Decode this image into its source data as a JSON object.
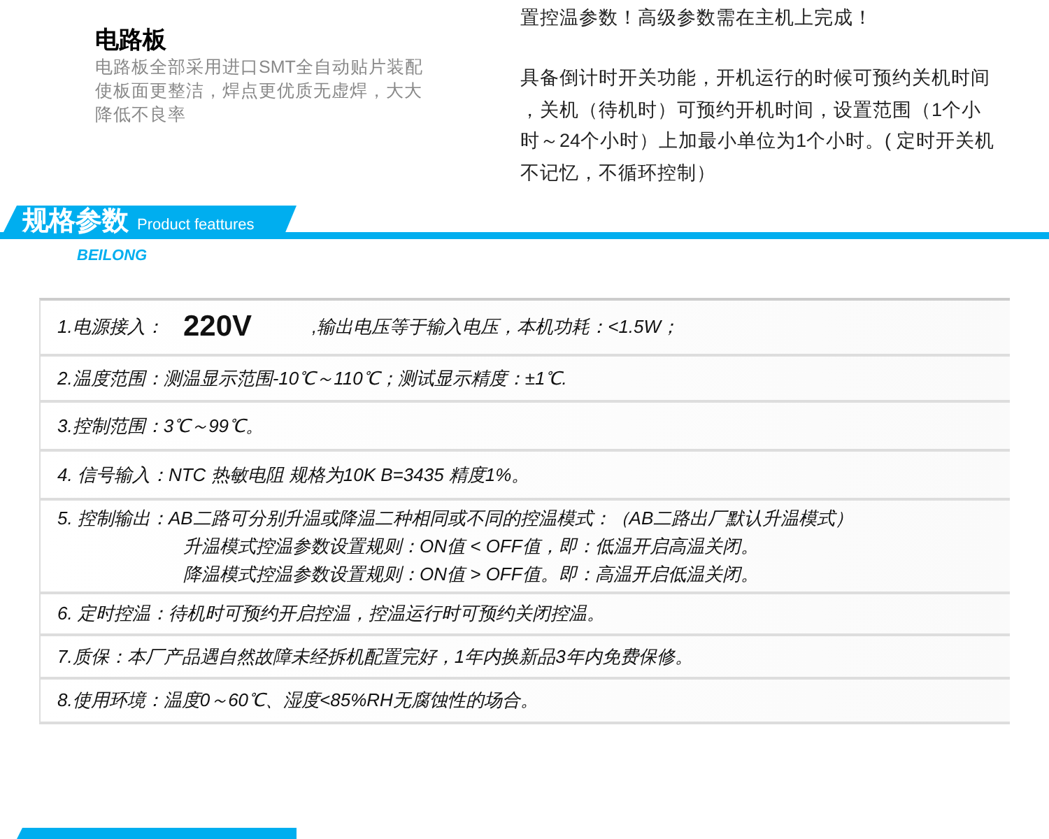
{
  "circuit_board": {
    "heading": "电路板",
    "description_lines": [
      "电路板全部采用进口SMT全自动贴片装配",
      "使板面更整洁，焊点更优质无虚焊，大大",
      "降低不良率"
    ]
  },
  "timer_text": {
    "intro": "置控温参数！高级参数需在主机上完成！",
    "lines": [
      "具备倒计时开关功能，开机运行的时候可预约关机时间",
      "，关机（待机时）可预约开机时间，设置范围（1个小",
      "时～24个小时）上加最小单位为1个小时。(  定时开关机",
      "不记忆，不循环控制）"
    ]
  },
  "section_banner": {
    "title": "规格参数",
    "subtitle": "Product feattures",
    "brand": "BEILONG"
  },
  "specs": [
    {
      "kind": "power",
      "label": "1.电源接入：",
      "value": "220V",
      "note": ",输出电压等于输入电压，本机功耗：<1.5W；"
    },
    {
      "kind": "text",
      "lines": [
        "2.温度范围：测温显示范围-10℃～110℃；测试显示精度：±1℃."
      ]
    },
    {
      "kind": "text",
      "lines": [
        "3.控制范围：3℃～99℃。"
      ]
    },
    {
      "kind": "text",
      "lines": [
        "4. 信号输入：NTC 热敏电阻  规格为10K  B=3435  精度1%。"
      ]
    },
    {
      "kind": "text",
      "lines": [
        "5. 控制输出：AB二路可分别升温或降温二种相同或不同的控温模式：（AB二路出厂默认升温模式）",
        "升温模式控温参数设置规则：ON值 < OFF值，即：低温开启高温关闭。",
        "降温模式控温参数设置规则：ON值 > OFF值。即：高温开启低温关闭。"
      ]
    },
    {
      "kind": "text",
      "lines": [
        "6. 定时控温：待机时可预约开启控温，控温运行时可预约关闭控温。"
      ]
    },
    {
      "kind": "text",
      "lines": [
        "7.质保：本厂产品遇自然故障未经拆机配置完好，1年内换新品3年内免费保修。"
      ]
    },
    {
      "kind": "text",
      "lines": [
        "8.使用环境：温度0～60℃、湿度<85%RH无腐蚀性的场合。"
      ]
    }
  ]
}
